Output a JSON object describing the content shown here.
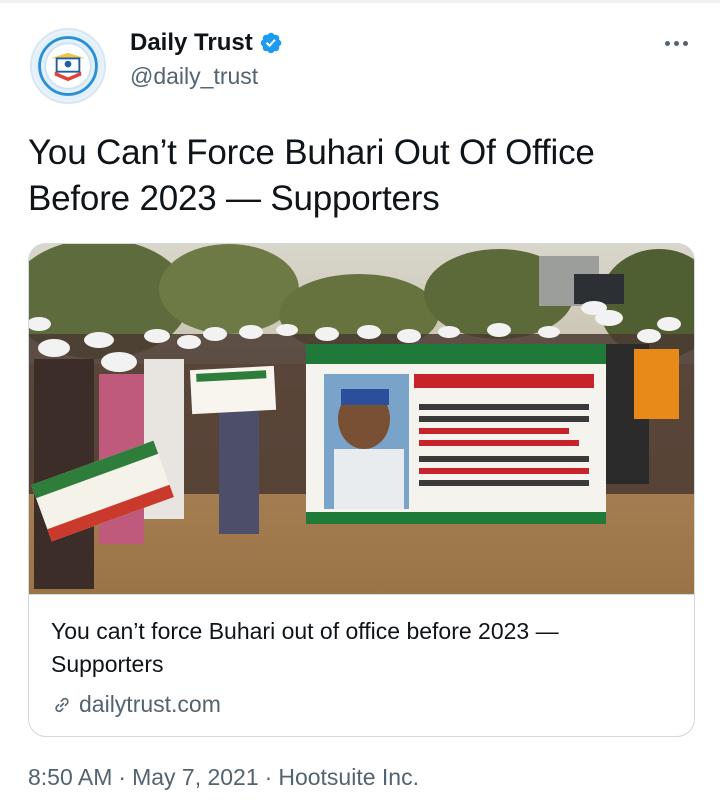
{
  "account": {
    "display_name": "Daily Trust",
    "handle": "@daily_trust",
    "verified": true,
    "avatar_icon": "daily-trust-logo-icon"
  },
  "tweet": {
    "text": "You Can’t Force Buhari Out Of Office Before 2023 — Supporters"
  },
  "card": {
    "image_icon": "supporters-holding-banners-photo",
    "image_banner_lines": [
      "COALITION FOR GOOD GOVERNANCE AND CHANGE INITIATI",
      "WE BELIEVE IN PRESIDENT MUHAMMADU",
      "SOCIAL INVESTMENT PROGRAM",
      "MR. PRESIDENT (N5000 STIPE",
      "A RESTORED SECURITY",
      "(BOKO HARAM HAS BEEN DEFE",
      "MEDICAL INTERVENTION OF MR. P",
      "N-POWER PROGRAMME OF MR. PRES",
      "WAR AGAINST CORRUPTION AND OTH"
    ],
    "title": "You can’t force Buhari out of office before 2023 — Supporters",
    "domain": "dailytrust.com"
  },
  "meta": {
    "time": "8:50 AM",
    "separator": "·",
    "date": "May 7, 2021",
    "source": "Hootsuite Inc."
  },
  "colors": {
    "text_primary": "#0f1419",
    "text_secondary": "#536471",
    "verified_blue": "#1d9bf0",
    "border": "#cfd9de"
  }
}
